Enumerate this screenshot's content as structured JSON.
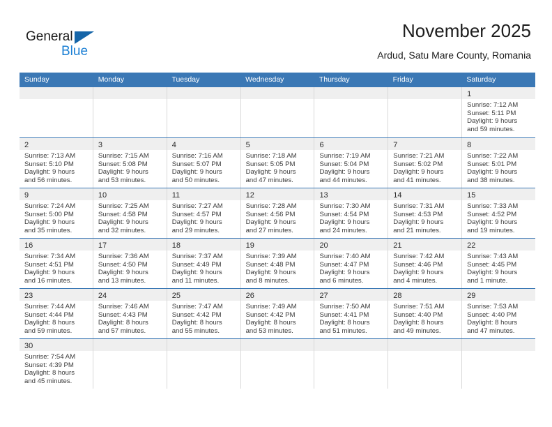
{
  "brand": {
    "name_part1": "General",
    "name_part2": "Blue",
    "triangle_color": "#1565a8",
    "blue_text_color": "#1b7fd4"
  },
  "header": {
    "title": "November 2025",
    "subtitle": "Ardud, Satu Mare County, Romania"
  },
  "theme": {
    "header_row_bg": "#3b78b5",
    "day_strip_bg": "#efefef",
    "cell_border": "#d8d8d8",
    "week_separator": "#3b78b5",
    "text": "#3a3a3a"
  },
  "weekdays": [
    "Sunday",
    "Monday",
    "Tuesday",
    "Wednesday",
    "Thursday",
    "Friday",
    "Saturday"
  ],
  "weeks": [
    [
      {
        "day": "",
        "lines": []
      },
      {
        "day": "",
        "lines": []
      },
      {
        "day": "",
        "lines": []
      },
      {
        "day": "",
        "lines": []
      },
      {
        "day": "",
        "lines": []
      },
      {
        "day": "",
        "lines": []
      },
      {
        "day": "1",
        "lines": [
          "Sunrise: 7:12 AM",
          "Sunset: 5:11 PM",
          "Daylight: 9 hours",
          "and 59 minutes."
        ]
      }
    ],
    [
      {
        "day": "2",
        "lines": [
          "Sunrise: 7:13 AM",
          "Sunset: 5:10 PM",
          "Daylight: 9 hours",
          "and 56 minutes."
        ]
      },
      {
        "day": "3",
        "lines": [
          "Sunrise: 7:15 AM",
          "Sunset: 5:08 PM",
          "Daylight: 9 hours",
          "and 53 minutes."
        ]
      },
      {
        "day": "4",
        "lines": [
          "Sunrise: 7:16 AM",
          "Sunset: 5:07 PM",
          "Daylight: 9 hours",
          "and 50 minutes."
        ]
      },
      {
        "day": "5",
        "lines": [
          "Sunrise: 7:18 AM",
          "Sunset: 5:05 PM",
          "Daylight: 9 hours",
          "and 47 minutes."
        ]
      },
      {
        "day": "6",
        "lines": [
          "Sunrise: 7:19 AM",
          "Sunset: 5:04 PM",
          "Daylight: 9 hours",
          "and 44 minutes."
        ]
      },
      {
        "day": "7",
        "lines": [
          "Sunrise: 7:21 AM",
          "Sunset: 5:02 PM",
          "Daylight: 9 hours",
          "and 41 minutes."
        ]
      },
      {
        "day": "8",
        "lines": [
          "Sunrise: 7:22 AM",
          "Sunset: 5:01 PM",
          "Daylight: 9 hours",
          "and 38 minutes."
        ]
      }
    ],
    [
      {
        "day": "9",
        "lines": [
          "Sunrise: 7:24 AM",
          "Sunset: 5:00 PM",
          "Daylight: 9 hours",
          "and 35 minutes."
        ]
      },
      {
        "day": "10",
        "lines": [
          "Sunrise: 7:25 AM",
          "Sunset: 4:58 PM",
          "Daylight: 9 hours",
          "and 32 minutes."
        ]
      },
      {
        "day": "11",
        "lines": [
          "Sunrise: 7:27 AM",
          "Sunset: 4:57 PM",
          "Daylight: 9 hours",
          "and 29 minutes."
        ]
      },
      {
        "day": "12",
        "lines": [
          "Sunrise: 7:28 AM",
          "Sunset: 4:56 PM",
          "Daylight: 9 hours",
          "and 27 minutes."
        ]
      },
      {
        "day": "13",
        "lines": [
          "Sunrise: 7:30 AM",
          "Sunset: 4:54 PM",
          "Daylight: 9 hours",
          "and 24 minutes."
        ]
      },
      {
        "day": "14",
        "lines": [
          "Sunrise: 7:31 AM",
          "Sunset: 4:53 PM",
          "Daylight: 9 hours",
          "and 21 minutes."
        ]
      },
      {
        "day": "15",
        "lines": [
          "Sunrise: 7:33 AM",
          "Sunset: 4:52 PM",
          "Daylight: 9 hours",
          "and 19 minutes."
        ]
      }
    ],
    [
      {
        "day": "16",
        "lines": [
          "Sunrise: 7:34 AM",
          "Sunset: 4:51 PM",
          "Daylight: 9 hours",
          "and 16 minutes."
        ]
      },
      {
        "day": "17",
        "lines": [
          "Sunrise: 7:36 AM",
          "Sunset: 4:50 PM",
          "Daylight: 9 hours",
          "and 13 minutes."
        ]
      },
      {
        "day": "18",
        "lines": [
          "Sunrise: 7:37 AM",
          "Sunset: 4:49 PM",
          "Daylight: 9 hours",
          "and 11 minutes."
        ]
      },
      {
        "day": "19",
        "lines": [
          "Sunrise: 7:39 AM",
          "Sunset: 4:48 PM",
          "Daylight: 9 hours",
          "and 8 minutes."
        ]
      },
      {
        "day": "20",
        "lines": [
          "Sunrise: 7:40 AM",
          "Sunset: 4:47 PM",
          "Daylight: 9 hours",
          "and 6 minutes."
        ]
      },
      {
        "day": "21",
        "lines": [
          "Sunrise: 7:42 AM",
          "Sunset: 4:46 PM",
          "Daylight: 9 hours",
          "and 4 minutes."
        ]
      },
      {
        "day": "22",
        "lines": [
          "Sunrise: 7:43 AM",
          "Sunset: 4:45 PM",
          "Daylight: 9 hours",
          "and 1 minute."
        ]
      }
    ],
    [
      {
        "day": "23",
        "lines": [
          "Sunrise: 7:44 AM",
          "Sunset: 4:44 PM",
          "Daylight: 8 hours",
          "and 59 minutes."
        ]
      },
      {
        "day": "24",
        "lines": [
          "Sunrise: 7:46 AM",
          "Sunset: 4:43 PM",
          "Daylight: 8 hours",
          "and 57 minutes."
        ]
      },
      {
        "day": "25",
        "lines": [
          "Sunrise: 7:47 AM",
          "Sunset: 4:42 PM",
          "Daylight: 8 hours",
          "and 55 minutes."
        ]
      },
      {
        "day": "26",
        "lines": [
          "Sunrise: 7:49 AM",
          "Sunset: 4:42 PM",
          "Daylight: 8 hours",
          "and 53 minutes."
        ]
      },
      {
        "day": "27",
        "lines": [
          "Sunrise: 7:50 AM",
          "Sunset: 4:41 PM",
          "Daylight: 8 hours",
          "and 51 minutes."
        ]
      },
      {
        "day": "28",
        "lines": [
          "Sunrise: 7:51 AM",
          "Sunset: 4:40 PM",
          "Daylight: 8 hours",
          "and 49 minutes."
        ]
      },
      {
        "day": "29",
        "lines": [
          "Sunrise: 7:53 AM",
          "Sunset: 4:40 PM",
          "Daylight: 8 hours",
          "and 47 minutes."
        ]
      }
    ],
    [
      {
        "day": "30",
        "lines": [
          "Sunrise: 7:54 AM",
          "Sunset: 4:39 PM",
          "Daylight: 8 hours",
          "and 45 minutes."
        ]
      },
      {
        "day": "",
        "lines": []
      },
      {
        "day": "",
        "lines": []
      },
      {
        "day": "",
        "lines": []
      },
      {
        "day": "",
        "lines": []
      },
      {
        "day": "",
        "lines": []
      },
      {
        "day": "",
        "lines": []
      }
    ]
  ]
}
